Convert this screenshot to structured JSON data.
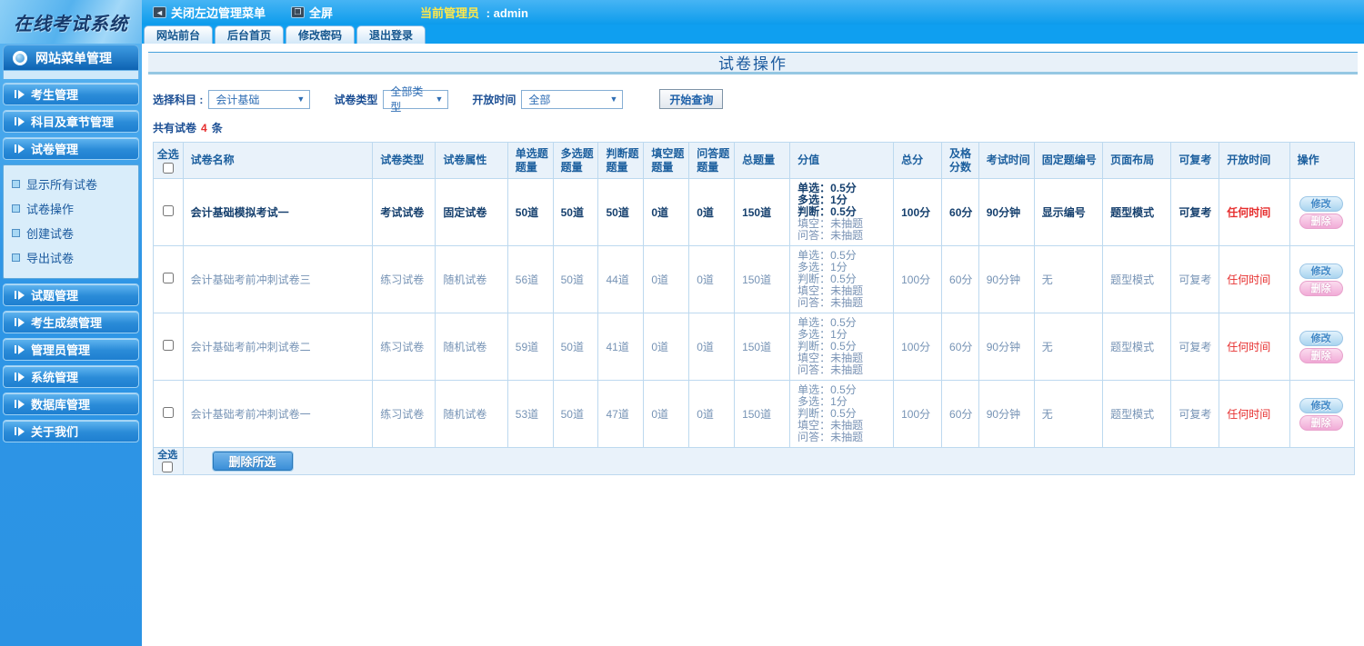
{
  "header": {
    "logo": "在线考试系统",
    "close_menu": "关闭左边管理菜单",
    "fullscreen": "全屏",
    "admin_label": "当前管理员",
    "admin_value": ": admin",
    "tabs": [
      "网站前台",
      "后台首页",
      "修改密码",
      "退出登录"
    ]
  },
  "sidebar": {
    "title": "网站菜单管理",
    "items": [
      {
        "label": "考生管理"
      },
      {
        "label": "科目及章节管理"
      },
      {
        "label": "试卷管理",
        "children": [
          "显示所有试卷",
          "试卷操作",
          "创建试卷",
          "导出试卷"
        ]
      },
      {
        "label": "试题管理"
      },
      {
        "label": "考生成绩管理"
      },
      {
        "label": "管理员管理"
      },
      {
        "label": "系统管理"
      },
      {
        "label": "数据库管理"
      },
      {
        "label": "关于我们"
      }
    ]
  },
  "main": {
    "page_title": "试卷操作",
    "filters": {
      "subject_label": "选择科目 :",
      "subject_value": "会计基础",
      "type_label": "试卷类型",
      "type_value": "全部类型",
      "time_label": "开放时间",
      "time_value": "全部",
      "search_button": "开始查询"
    },
    "count": {
      "prefix": "共有试卷",
      "num": "4",
      "suffix": "条"
    },
    "table": {
      "headers": [
        "全选",
        "试卷名称",
        "试卷类型",
        "试卷属性",
        "单选题题量",
        "多选题题量",
        "判断题题量",
        "填空题题量",
        "问答题题量",
        "总题量",
        "分值",
        "总分",
        "及格分数",
        "考试时间",
        "固定题编号",
        "页面布局",
        "可复考",
        "开放时间",
        "操作"
      ],
      "actions": {
        "modify": "修改",
        "delete": "删除"
      },
      "footer": {
        "select_all": "全选",
        "delete_selected": "删除所选"
      },
      "rows": [
        {
          "name": "会计基础模拟考试一",
          "type": "考试试卷",
          "attr": "固定试卷",
          "single": "50道",
          "multi": "50道",
          "judge": "50道",
          "blank": "0道",
          "qa": "0道",
          "total": "150道",
          "score_lines": [
            {
              "text": "单选：0.5分",
              "muted": false
            },
            {
              "text": "多选：1分",
              "muted": false
            },
            {
              "text": "判断：0.5分",
              "muted": false
            },
            {
              "text": "填空：未抽题",
              "muted": true
            },
            {
              "text": "问答：未抽题",
              "muted": true
            }
          ],
          "total_score": "100分",
          "pass_score": "60分",
          "exam_time": "90分钟",
          "fixed_num": "显示编号",
          "layout": "题型模式",
          "retake": "可复考",
          "open_time": "任何时间",
          "emphasis": true
        },
        {
          "name": "会计基础考前冲刺试卷三",
          "type": "练习试卷",
          "attr": "随机试卷",
          "single": "56道",
          "multi": "50道",
          "judge": "44道",
          "blank": "0道",
          "qa": "0道",
          "total": "150道",
          "score_lines": [
            {
              "text": "单选：0.5分",
              "muted": false
            },
            {
              "text": "多选：1分",
              "muted": false
            },
            {
              "text": "判断：0.5分",
              "muted": false
            },
            {
              "text": "填空：未抽题",
              "muted": true
            },
            {
              "text": "问答：未抽题",
              "muted": true
            }
          ],
          "total_score": "100分",
          "pass_score": "60分",
          "exam_time": "90分钟",
          "fixed_num": "无",
          "layout": "题型模式",
          "retake": "可复考",
          "open_time": "任何时间",
          "emphasis": false
        },
        {
          "name": "会计基础考前冲刺试卷二",
          "type": "练习试卷",
          "attr": "随机试卷",
          "single": "59道",
          "multi": "50道",
          "judge": "41道",
          "blank": "0道",
          "qa": "0道",
          "total": "150道",
          "score_lines": [
            {
              "text": "单选：0.5分",
              "muted": false
            },
            {
              "text": "多选：1分",
              "muted": false
            },
            {
              "text": "判断：0.5分",
              "muted": false
            },
            {
              "text": "填空：未抽题",
              "muted": true
            },
            {
              "text": "问答：未抽题",
              "muted": true
            }
          ],
          "total_score": "100分",
          "pass_score": "60分",
          "exam_time": "90分钟",
          "fixed_num": "无",
          "layout": "题型模式",
          "retake": "可复考",
          "open_time": "任何时间",
          "emphasis": false
        },
        {
          "name": "会计基础考前冲刺试卷一",
          "type": "练习试卷",
          "attr": "随机试卷",
          "single": "53道",
          "multi": "50道",
          "judge": "47道",
          "blank": "0道",
          "qa": "0道",
          "total": "150道",
          "score_lines": [
            {
              "text": "单选：0.5分",
              "muted": false
            },
            {
              "text": "多选：1分",
              "muted": false
            },
            {
              "text": "判断：0.5分",
              "muted": false
            },
            {
              "text": "填空：未抽题",
              "muted": true
            },
            {
              "text": "问答：未抽题",
              "muted": true
            }
          ],
          "total_score": "100分",
          "pass_score": "60分",
          "exam_time": "90分钟",
          "fixed_num": "无",
          "layout": "题型模式",
          "retake": "可复考",
          "open_time": "任何时间",
          "emphasis": false
        }
      ]
    }
  }
}
